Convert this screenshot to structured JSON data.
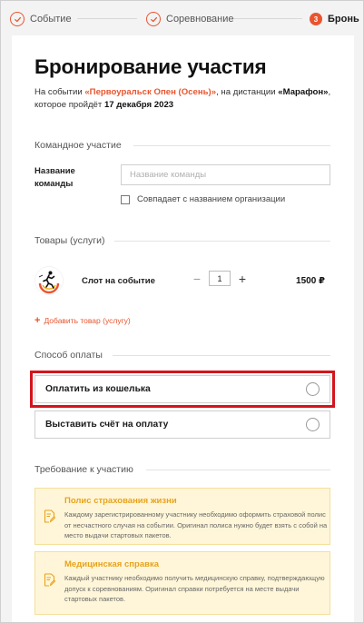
{
  "stepper": {
    "steps": [
      {
        "label": "Событие",
        "state": "done"
      },
      {
        "label": "Соревнование",
        "state": "done"
      },
      {
        "label": "Бронь",
        "number": "3",
        "state": "active"
      }
    ]
  },
  "page": {
    "title": "Бронирование участия",
    "subtitle_prefix": "На событии ",
    "event_name": "«Первоуральск Опен (Осень)»",
    "subtitle_mid": ", на дистанции ",
    "distance": "«Марафон»",
    "subtitle_mid2": ", которое пройдёт ",
    "date": "17 декабря 2023"
  },
  "team": {
    "section_title": "Командное участие",
    "name_label": "Название команды",
    "name_placeholder": "Название команды",
    "name_value": "",
    "same_as_org_label": "Совпадает с названием организации"
  },
  "goods": {
    "section_title": "Товары (услуги)",
    "items": [
      {
        "name": "Слот на событие",
        "quantity": "1",
        "price": "1500 ₽",
        "logo_icon": "runner-logo-icon"
      }
    ],
    "minus": "−",
    "plus": "+",
    "add_label": "Добавить товар (услугу)"
  },
  "payment": {
    "section_title": "Способ оплаты",
    "options": [
      {
        "label": "Оплатить из кошелька",
        "highlighted": true
      },
      {
        "label": "Выставить счёт на оплату",
        "highlighted": false
      }
    ]
  },
  "requirements": {
    "section_title": "Требование к участию",
    "items": [
      {
        "title": "Полис страхования жизни",
        "text": "Каждому зарегистрированному участнику необходимо оформить страховой полис от несчастного случая на событии. Оригинал полиса нужно будет взять с собой на место выдачи стартовых пакетов.",
        "icon": "document-edit-icon"
      },
      {
        "title": "Медицинская справка",
        "text": "Каждый участнику необходимо получить медицинскую справку, подтверждающую допуск к соревнованиям. Оригинал справки потребуется на месте выдачи стартовых пакетов.",
        "icon": "document-edit-icon"
      }
    ]
  },
  "colors": {
    "accent": "#e8552f",
    "highlight_border": "#d4141c",
    "requirement_bg": "#fff6d9",
    "requirement_title": "#e8a21a"
  }
}
